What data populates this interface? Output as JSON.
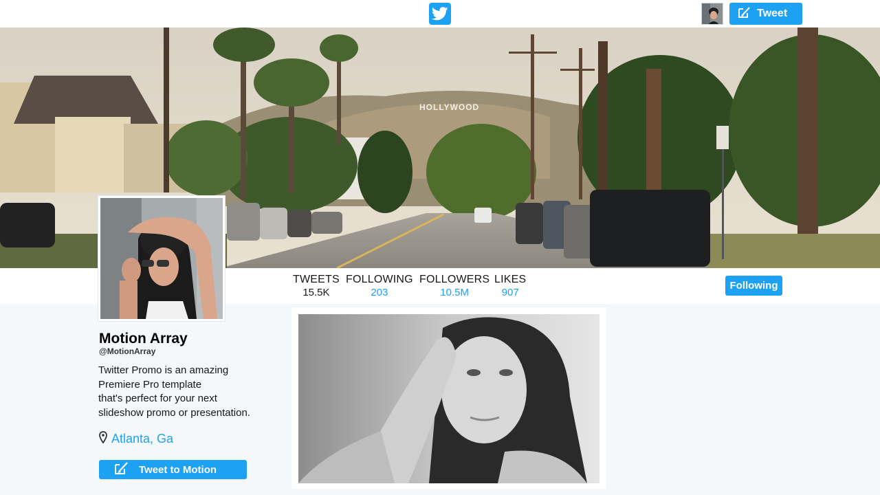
{
  "topbar": {
    "logo_icon": "twitter-bird-icon",
    "tweet_button_label": "Tweet",
    "tweet_button_icon": "compose-icon"
  },
  "banner": {
    "sign_text": "HOLLYWOOD"
  },
  "stats": [
    {
      "label": "TWEETS",
      "value": "15.5K"
    },
    {
      "label": "FOLLOWING",
      "value": "203"
    },
    {
      "label": "FOLLOWERS",
      "value": "10.5M"
    },
    {
      "label": "LIKES",
      "value": "907"
    }
  ],
  "follow_button_label": "Following",
  "profile": {
    "name": "Motion Array",
    "handle": "@MotionArray",
    "bio_lines": [
      "Twitter Promo is an amazing",
      "Premiere Pro template",
      "that's perfect for your next",
      "slideshow promo or presentation."
    ],
    "location": "Atlanta, Ga",
    "location_icon": "map-pin-icon",
    "tweet_to_label": "Tweet to Motion",
    "tweet_to_icon": "compose-icon"
  },
  "colors": {
    "accent": "#1da1f2",
    "background": "#f5f8fa",
    "text": "#14171a"
  }
}
